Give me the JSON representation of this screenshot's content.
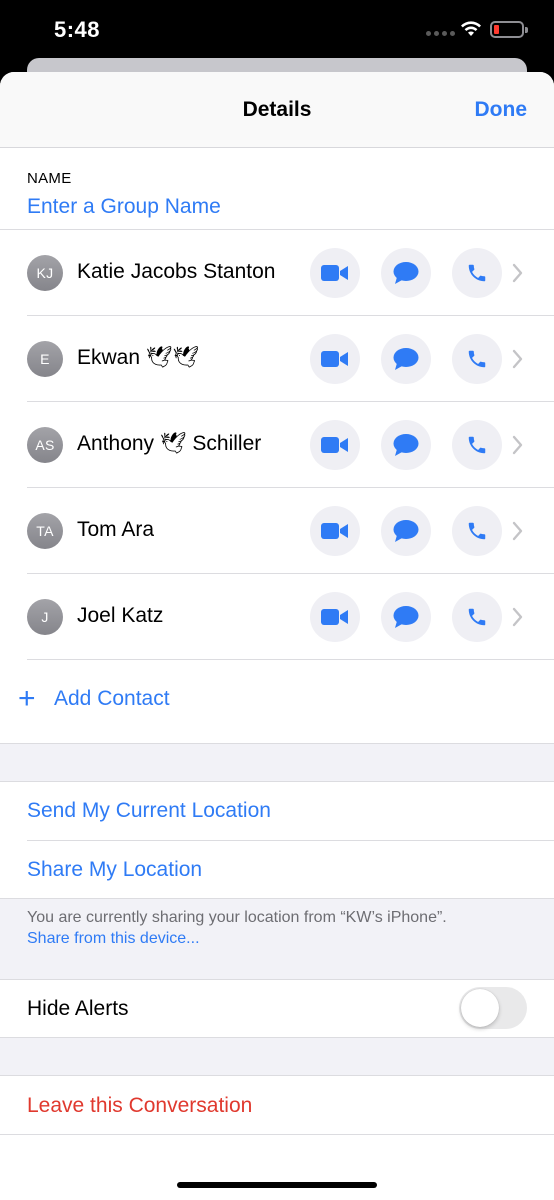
{
  "status_bar": {
    "time": "5:48"
  },
  "header": {
    "title": "Details",
    "done_label": "Done"
  },
  "name_section": {
    "label": "NAME",
    "placeholder": "Enter a Group Name"
  },
  "contacts": [
    {
      "initials": "KJ",
      "name": "Katie Jacobs Stanton"
    },
    {
      "initials": "E",
      "name": "Ekwan 🕊🕊"
    },
    {
      "initials": "AS",
      "name": "Anthony 🕊 Schiller"
    },
    {
      "initials": "TA",
      "name": "Tom Ara"
    },
    {
      "initials": "J",
      "name": "Joel Katz"
    }
  ],
  "add_contact": {
    "plus": "+",
    "label": "Add Contact"
  },
  "location": {
    "send_label": "Send My Current Location",
    "share_label": "Share My Location",
    "footnote": "You are currently sharing your location from “KW’s iPhone”.",
    "footnote_link": "Share from this device..."
  },
  "alerts": {
    "label": "Hide Alerts",
    "enabled": false
  },
  "leave": {
    "label": "Leave this Conversation"
  },
  "colors": {
    "accent": "#2f7bf5",
    "destructive": "#e0392e",
    "battery_low": "#ff3b30"
  }
}
